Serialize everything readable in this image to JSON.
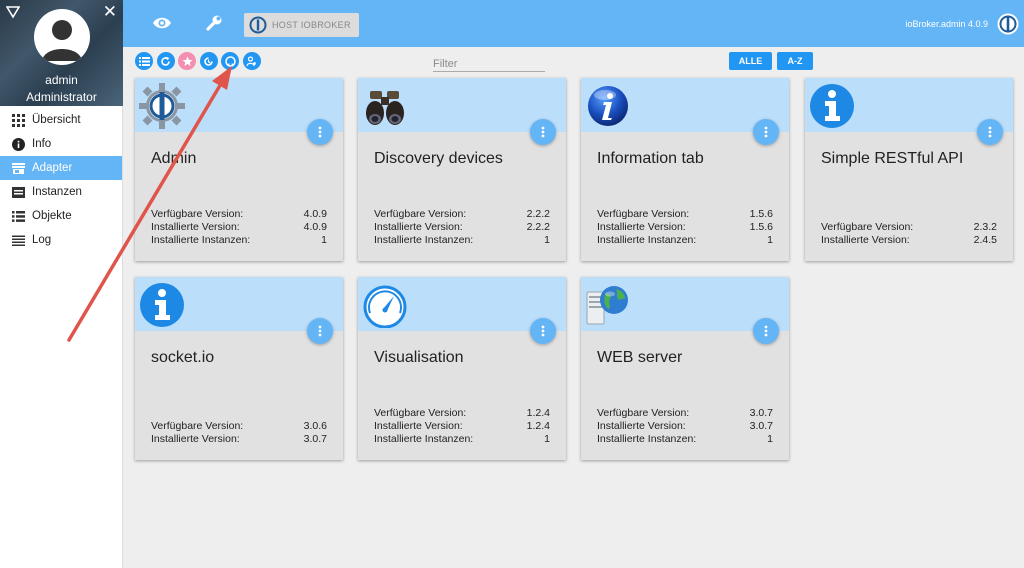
{
  "sidebar": {
    "user_name": "admin",
    "user_role": "Administrator",
    "items": [
      {
        "label": "Übersicht",
        "icon": "apps-grid-icon"
      },
      {
        "label": "Info",
        "icon": "info-circle-icon"
      },
      {
        "label": "Adapter",
        "icon": "store-icon"
      },
      {
        "label": "Instanzen",
        "icon": "instances-icon"
      },
      {
        "label": "Objekte",
        "icon": "list-icon"
      },
      {
        "label": "Log",
        "icon": "lines-icon"
      }
    ],
    "active_item": "Adapter"
  },
  "topbar": {
    "host_label": "HOST IOBROKER",
    "version": "ioBroker.admin 4.0.9"
  },
  "toolbar": {
    "filter_placeholder": "Filter",
    "filter_value": "",
    "all_label": "ALLE",
    "az_label": "A-Z",
    "icon_buttons": [
      "list-view-icon",
      "refresh-icon",
      "star-icon",
      "update-icon",
      "github-icon",
      "custom-install-icon"
    ]
  },
  "adapters": [
    {
      "title": "Admin",
      "icon": "iobroker-gear-icon",
      "available_label": "Verfügbare Version:",
      "available": "4.0.9",
      "installed_label": "Installierte Version:",
      "installed": "4.0.9",
      "instances_label": "Installierte Instanzen:",
      "instances": "1"
    },
    {
      "title": "Discovery devices",
      "icon": "binoculars-icon",
      "available_label": "Verfügbare Version:",
      "available": "2.2.2",
      "installed_label": "Installierte Version:",
      "installed": "2.2.2",
      "instances_label": "Installierte Instanzen:",
      "instances": "1"
    },
    {
      "title": "Information tab",
      "icon": "info-sphere-icon",
      "available_label": "Verfügbare Version:",
      "available": "1.5.6",
      "installed_label": "Installierte Version:",
      "installed": "1.5.6",
      "instances_label": "Installierte Instanzen:",
      "instances": "1"
    },
    {
      "title": "Simple RESTful API",
      "icon": "info-blue-icon",
      "available_label": "Verfügbare Version:",
      "available": "2.3.2",
      "installed_label": "Installierte Version:",
      "installed": "2.4.5"
    },
    {
      "title": "socket.io",
      "icon": "info-blue-icon",
      "available_label": "Verfügbare Version:",
      "available": "3.0.6",
      "installed_label": "Installierte Version:",
      "installed": "3.0.7"
    },
    {
      "title": "Visualisation",
      "icon": "gauge-icon",
      "available_label": "Verfügbare Version:",
      "available": "1.2.4",
      "installed_label": "Installierte Version:",
      "installed": "1.2.4",
      "instances_label": "Installierte Instanzen:",
      "instances": "1"
    },
    {
      "title": "WEB server",
      "icon": "web-server-globe-icon",
      "available_label": "Verfügbare Version:",
      "available": "3.0.7",
      "installed_label": "Installierte Version:",
      "installed": "3.0.7",
      "instances_label": "Installierte Instanzen:",
      "instances": "1"
    }
  ],
  "colors": {
    "accent": "#64b5f6",
    "primary_button": "#2196f3",
    "card_header": "#bbdefb",
    "card_body": "#e1e1e1",
    "annotation_arrow": "#e0554b"
  }
}
